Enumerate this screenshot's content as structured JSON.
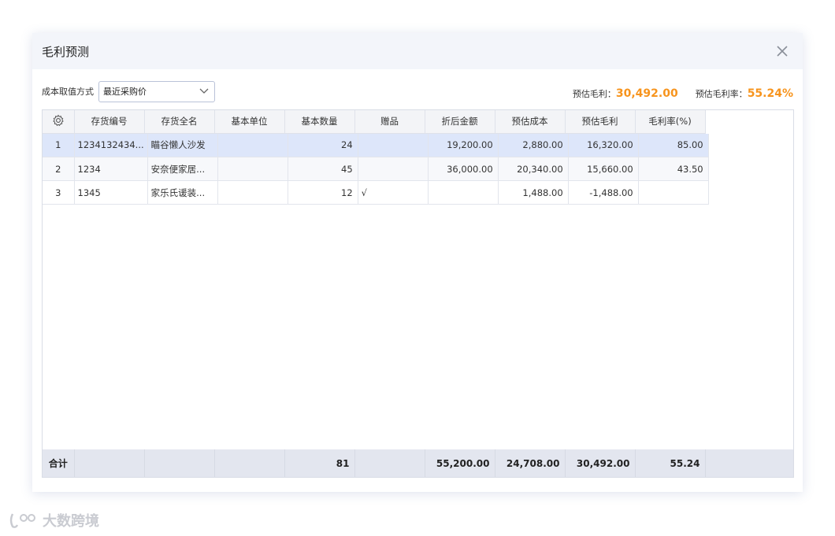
{
  "dialog": {
    "title": "毛利预测"
  },
  "toolbar": {
    "cost_label": "成本取值方式",
    "cost_method": "最近采购价",
    "gross_profit_label": "预估毛利：",
    "gross_profit_value": "30,492.00",
    "gross_margin_label": "预估毛利率：",
    "gross_margin_value": "55.24%"
  },
  "table": {
    "columns": [
      "",
      "存货编号",
      "存货全名",
      "基本单位",
      "基本数量",
      "赠品",
      "折后金额",
      "预估成本",
      "预估毛利",
      "毛利率(%)"
    ],
    "rows": [
      {
        "idx": "1",
        "code": "1234132434...",
        "name": "瞄谷懒人沙发",
        "unit": "",
        "qty": "24",
        "gift": "",
        "amount": "19,200.00",
        "cost": "2,880.00",
        "profit": "16,320.00",
        "margin": "85.00"
      },
      {
        "idx": "2",
        "code": "1234",
        "name": "安奈便家居...",
        "unit": "",
        "qty": "45",
        "gift": "",
        "amount": "36,000.00",
        "cost": "20,340.00",
        "profit": "15,660.00",
        "margin": "43.50"
      },
      {
        "idx": "3",
        "code": "1345",
        "name": "家乐氏谖装...",
        "unit": "",
        "qty": "12",
        "gift": "√",
        "amount": "",
        "cost": "1,488.00",
        "profit": "-1,488.00",
        "margin": ""
      }
    ],
    "footer": {
      "label": "合计",
      "qty": "81",
      "amount": "55,200.00",
      "cost": "24,708.00",
      "profit": "30,492.00",
      "margin": "55.24"
    }
  },
  "watermark": {
    "text": "大数跨境"
  },
  "colors": {
    "accent_orange": "#f7941d",
    "selected_row": "#dde6fa",
    "footer_bg": "#e3e6ef"
  }
}
